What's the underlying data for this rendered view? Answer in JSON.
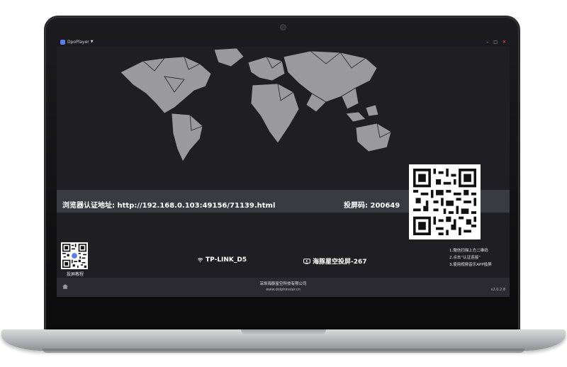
{
  "window": {
    "app_title": "DpoPlayer",
    "controls": {
      "minimize": "–",
      "maximize": "□",
      "close": "✕"
    }
  },
  "main": {
    "auth_label": "浏览器认证地址: http://192.168.0.103:49156/71139.html",
    "cast_code": "投屏码: 200649"
  },
  "tutorial": {
    "caption": "投屏教程"
  },
  "status": {
    "wifi_icon": "wifi-icon",
    "wifi_name": "TP-LINK_D5",
    "device_icon": "cast-device-icon",
    "device_name": "海豚星空投屏-267"
  },
  "steps": [
    "1.微信扫描上方二维码",
    "2.点击“认证连接”",
    "3.使用视频音乐APP投屏"
  ],
  "footer": {
    "company": "深圳海豚星空科技有限公司",
    "website": "www.dolphinstar.cn",
    "version": "v2.0.2.8"
  },
  "colors": {
    "screen_bg": "#1f1f23",
    "band_bg": "#3a3a41",
    "footer_bg": "#2a2a30",
    "map_gray": "#9a9a9e",
    "accent": "#5b7de8",
    "close_red": "#ff4a4a"
  }
}
